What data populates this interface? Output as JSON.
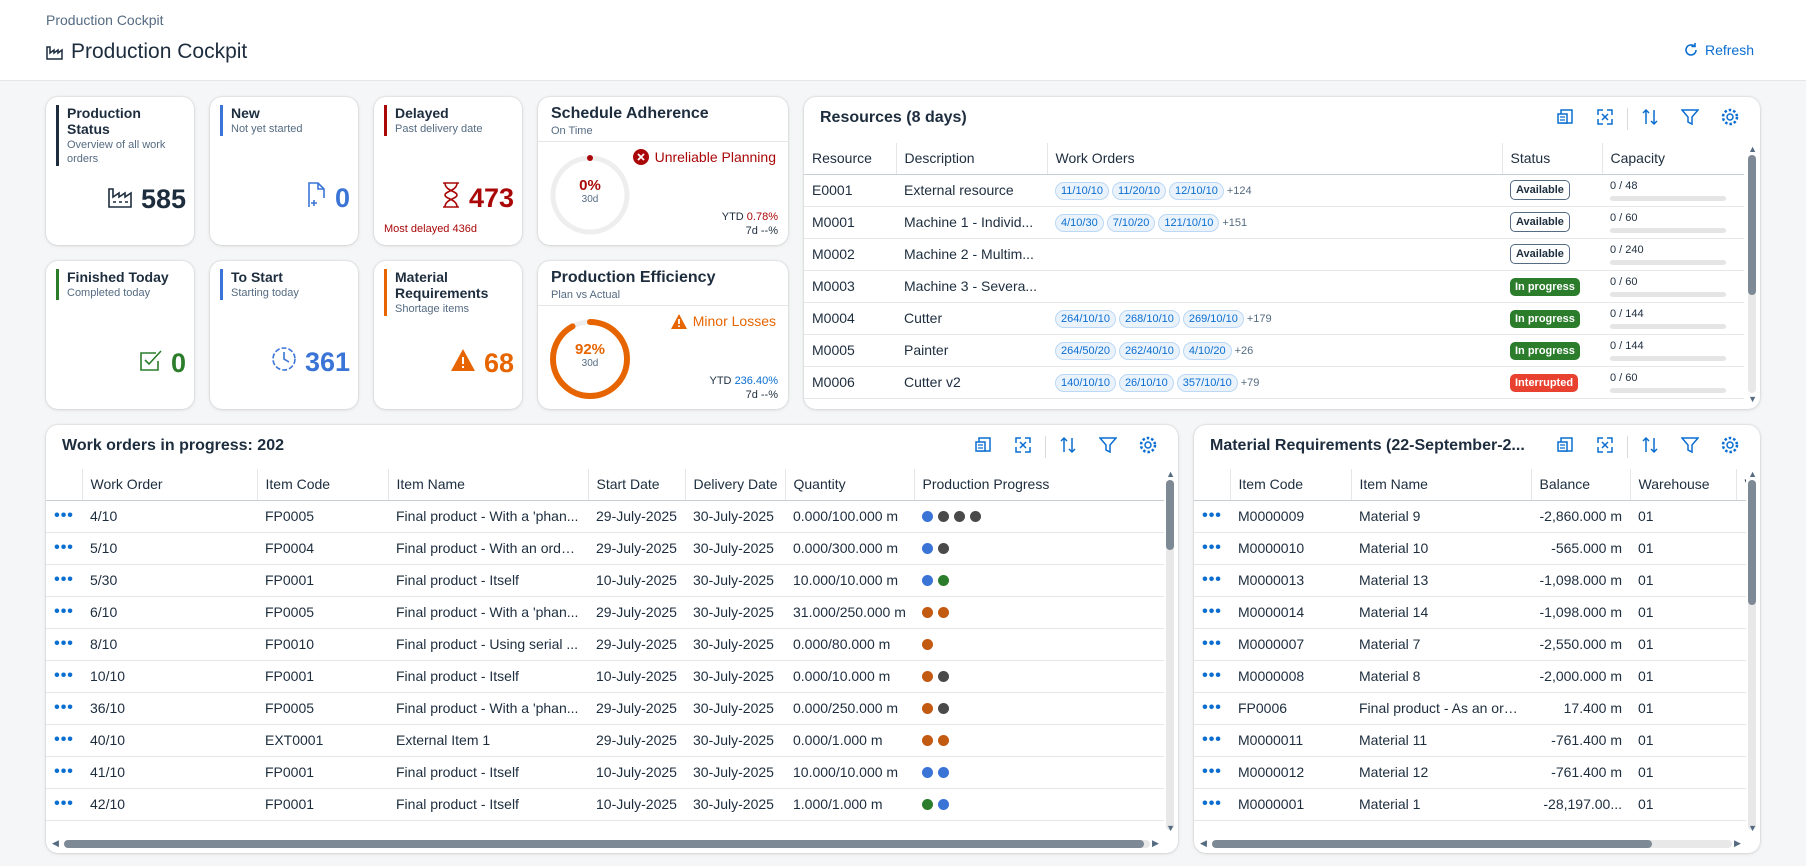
{
  "header": {
    "breadcrumb": "Production Cockpit",
    "title": "Production Cockpit",
    "refresh_label": "Refresh"
  },
  "kpis": [
    {
      "title": "Production Status",
      "subtitle": "Overview of all work orders",
      "value": "585",
      "color": "#1d2d3e",
      "bar": "#1d2d3e",
      "icon": "factory-icon",
      "footer": ""
    },
    {
      "title": "New",
      "subtitle": "Not yet started",
      "value": "0",
      "color": "#3a74d6",
      "bar": "#3a74d6",
      "icon": "new-document-icon",
      "footer": ""
    },
    {
      "title": "Delayed",
      "subtitle": "Past delivery date",
      "value": "473",
      "color": "#aa0808",
      "bar": "#aa0808",
      "icon": "hourglass-icon",
      "footer": "Most delayed 436d"
    },
    {
      "title": "Finished Today",
      "subtitle": "Completed today",
      "value": "0",
      "color": "#2b7d2b",
      "bar": "#2b7d2b",
      "icon": "checkbox-icon",
      "footer": ""
    },
    {
      "title": "To Start",
      "subtitle": "Starting today",
      "value": "361",
      "color": "#3a74d6",
      "bar": "#3a74d6",
      "icon": "clock-icon",
      "footer": ""
    },
    {
      "title": "Material Requirements",
      "subtitle": "Shortage items",
      "value": "68",
      "color": "#e76500",
      "bar": "#e76500",
      "icon": "warning-icon",
      "footer": ""
    }
  ],
  "schedule": {
    "title": "Schedule Adherence",
    "subtitle": "On Time",
    "percent": "0%",
    "period": "30d",
    "status": "Unreliable Planning",
    "ytd_label": "YTD",
    "ytd_value": "0.78%",
    "d7": "7d --%",
    "fill": 0.0,
    "color": "#aa0808"
  },
  "efficiency": {
    "title": "Production Efficiency",
    "subtitle": "Plan vs Actual",
    "percent": "92%",
    "period": "30d",
    "status": "Minor Losses",
    "ytd_label": "YTD",
    "ytd_value": "236.40%",
    "d7": "7d --%",
    "fill": 0.92,
    "color": "#e76500"
  },
  "resources": {
    "title": "Resources (8 days)",
    "columns": [
      "Resource",
      "Description",
      "Work Orders",
      "Status",
      "Capacity"
    ],
    "rows": [
      {
        "id": "E0001",
        "desc": "External resource",
        "orders": [
          "11/10/10",
          "11/20/10",
          "12/10/10"
        ],
        "more": "+124",
        "status": "Available",
        "status_type": "available",
        "cap": "0 / 48"
      },
      {
        "id": "M0001",
        "desc": "Machine 1 - Individ...",
        "orders": [
          "4/10/30",
          "7/10/20",
          "121/10/10"
        ],
        "more": "+151",
        "status": "Available",
        "status_type": "available",
        "cap": "0 / 60"
      },
      {
        "id": "M0002",
        "desc": "Machine 2 - Multim...",
        "orders": [],
        "more": "",
        "status": "Available",
        "status_type": "available",
        "cap": "0 / 240"
      },
      {
        "id": "M0003",
        "desc": "Machine 3 - Severa...",
        "orders": [],
        "more": "",
        "status": "In progress",
        "status_type": "inprogress",
        "cap": "0 / 60"
      },
      {
        "id": "M0004",
        "desc": "Cutter",
        "orders": [
          "264/10/10",
          "268/10/10",
          "269/10/10"
        ],
        "more": "+179",
        "status": "In progress",
        "status_type": "inprogress",
        "cap": "0 / 144"
      },
      {
        "id": "M0005",
        "desc": "Painter",
        "orders": [
          "264/50/20",
          "262/40/10",
          "4/10/20"
        ],
        "more": "+26",
        "status": "In progress",
        "status_type": "inprogress",
        "cap": "0 / 144"
      },
      {
        "id": "M0006",
        "desc": "Cutter v2",
        "orders": [
          "140/10/10",
          "26/10/10",
          "357/10/10"
        ],
        "more": "+79",
        "status": "Interrupted",
        "status_type": "interrupted",
        "cap": "0 / 60"
      }
    ]
  },
  "workorders": {
    "title": "Work orders in progress: 202",
    "columns": [
      "Work Order",
      "Item Code",
      "Item Name",
      "Start Date",
      "Delivery Date",
      "Quantity",
      "Production Progress"
    ],
    "rows": [
      {
        "wo": "4/10",
        "code": "FP0005",
        "name": "Final product - With a 'phan...",
        "start": "29-July-2025",
        "delivery": "30-July-2025",
        "qty": "0.000/100.000 m",
        "dots": [
          "#3a74d6",
          "#4a4a4a",
          "#4a4a4a",
          "#4a4a4a"
        ]
      },
      {
        "wo": "5/10",
        "code": "FP0004",
        "name": "Final product - With an orde...",
        "start": "29-July-2025",
        "delivery": "30-July-2025",
        "qty": "0.000/300.000 m",
        "dots": [
          "#3a74d6",
          "#4a4a4a"
        ]
      },
      {
        "wo": "5/30",
        "code": "FP0001",
        "name": "Final product - Itself",
        "start": "10-July-2025",
        "delivery": "30-July-2025",
        "qty": "10.000/10.000 m",
        "dots": [
          "#3a74d6",
          "#2b7d2b"
        ]
      },
      {
        "wo": "6/10",
        "code": "FP0005",
        "name": "Final product - With a 'phan...",
        "start": "29-July-2025",
        "delivery": "30-July-2025",
        "qty": "31.000/250.000 m",
        "dots": [
          "#c25a12",
          "#c25a12"
        ]
      },
      {
        "wo": "8/10",
        "code": "FP0010",
        "name": "Final product - Using serial ...",
        "start": "29-July-2025",
        "delivery": "30-July-2025",
        "qty": "0.000/80.000 m",
        "dots": [
          "#c25a12"
        ]
      },
      {
        "wo": "10/10",
        "code": "FP0001",
        "name": "Final product - Itself",
        "start": "10-July-2025",
        "delivery": "30-July-2025",
        "qty": "0.000/10.000 m",
        "dots": [
          "#c25a12",
          "#4a4a4a"
        ]
      },
      {
        "wo": "36/10",
        "code": "FP0005",
        "name": "Final product - With a 'phan...",
        "start": "29-July-2025",
        "delivery": "30-July-2025",
        "qty": "0.000/250.000 m",
        "dots": [
          "#c25a12",
          "#4a4a4a"
        ]
      },
      {
        "wo": "40/10",
        "code": "EXT0001",
        "name": "External Item 1",
        "start": "29-July-2025",
        "delivery": "30-July-2025",
        "qty": "0.000/1.000 m",
        "dots": [
          "#c25a12",
          "#c25a12"
        ]
      },
      {
        "wo": "41/10",
        "code": "FP0001",
        "name": "Final product - Itself",
        "start": "10-July-2025",
        "delivery": "30-July-2025",
        "qty": "10.000/10.000 m",
        "dots": [
          "#3a74d6",
          "#3a74d6"
        ]
      },
      {
        "wo": "42/10",
        "code": "FP0001",
        "name": "Final product - Itself",
        "start": "10-July-2025",
        "delivery": "30-July-2025",
        "qty": "1.000/1.000 m",
        "dots": [
          "#2b7d2b",
          "#3a74d6"
        ]
      }
    ]
  },
  "materials": {
    "title": "Material Requirements (22-September-2...",
    "columns": [
      "Item Code",
      "Item Name",
      "Balance",
      "Warehouse"
    ],
    "rows": [
      {
        "code": "M0000009",
        "name": "Material 9",
        "balance": "-2,860.000 m",
        "wh": "01"
      },
      {
        "code": "M0000010",
        "name": "Material 10",
        "balance": "-565.000 m",
        "wh": "01"
      },
      {
        "code": "M0000013",
        "name": "Material 13",
        "balance": "-1,098.000 m",
        "wh": "01"
      },
      {
        "code": "M0000014",
        "name": "Material 14",
        "balance": "-1,098.000 m",
        "wh": "01"
      },
      {
        "code": "M0000007",
        "name": "Material 7",
        "balance": "-2,550.000 m",
        "wh": "01"
      },
      {
        "code": "M0000008",
        "name": "Material 8",
        "balance": "-2,000.000 m",
        "wh": "01"
      },
      {
        "code": "FP0006",
        "name": "Final product - As an ord...",
        "balance": "17.400 m",
        "wh": "01"
      },
      {
        "code": "M0000011",
        "name": "Material 11",
        "balance": "-761.400 m",
        "wh": "01"
      },
      {
        "code": "M0000012",
        "name": "Material 12",
        "balance": "-761.400 m",
        "wh": "01"
      },
      {
        "code": "M0000001",
        "name": "Material 1",
        "balance": "-28,197.00...",
        "wh": "01"
      }
    ]
  }
}
